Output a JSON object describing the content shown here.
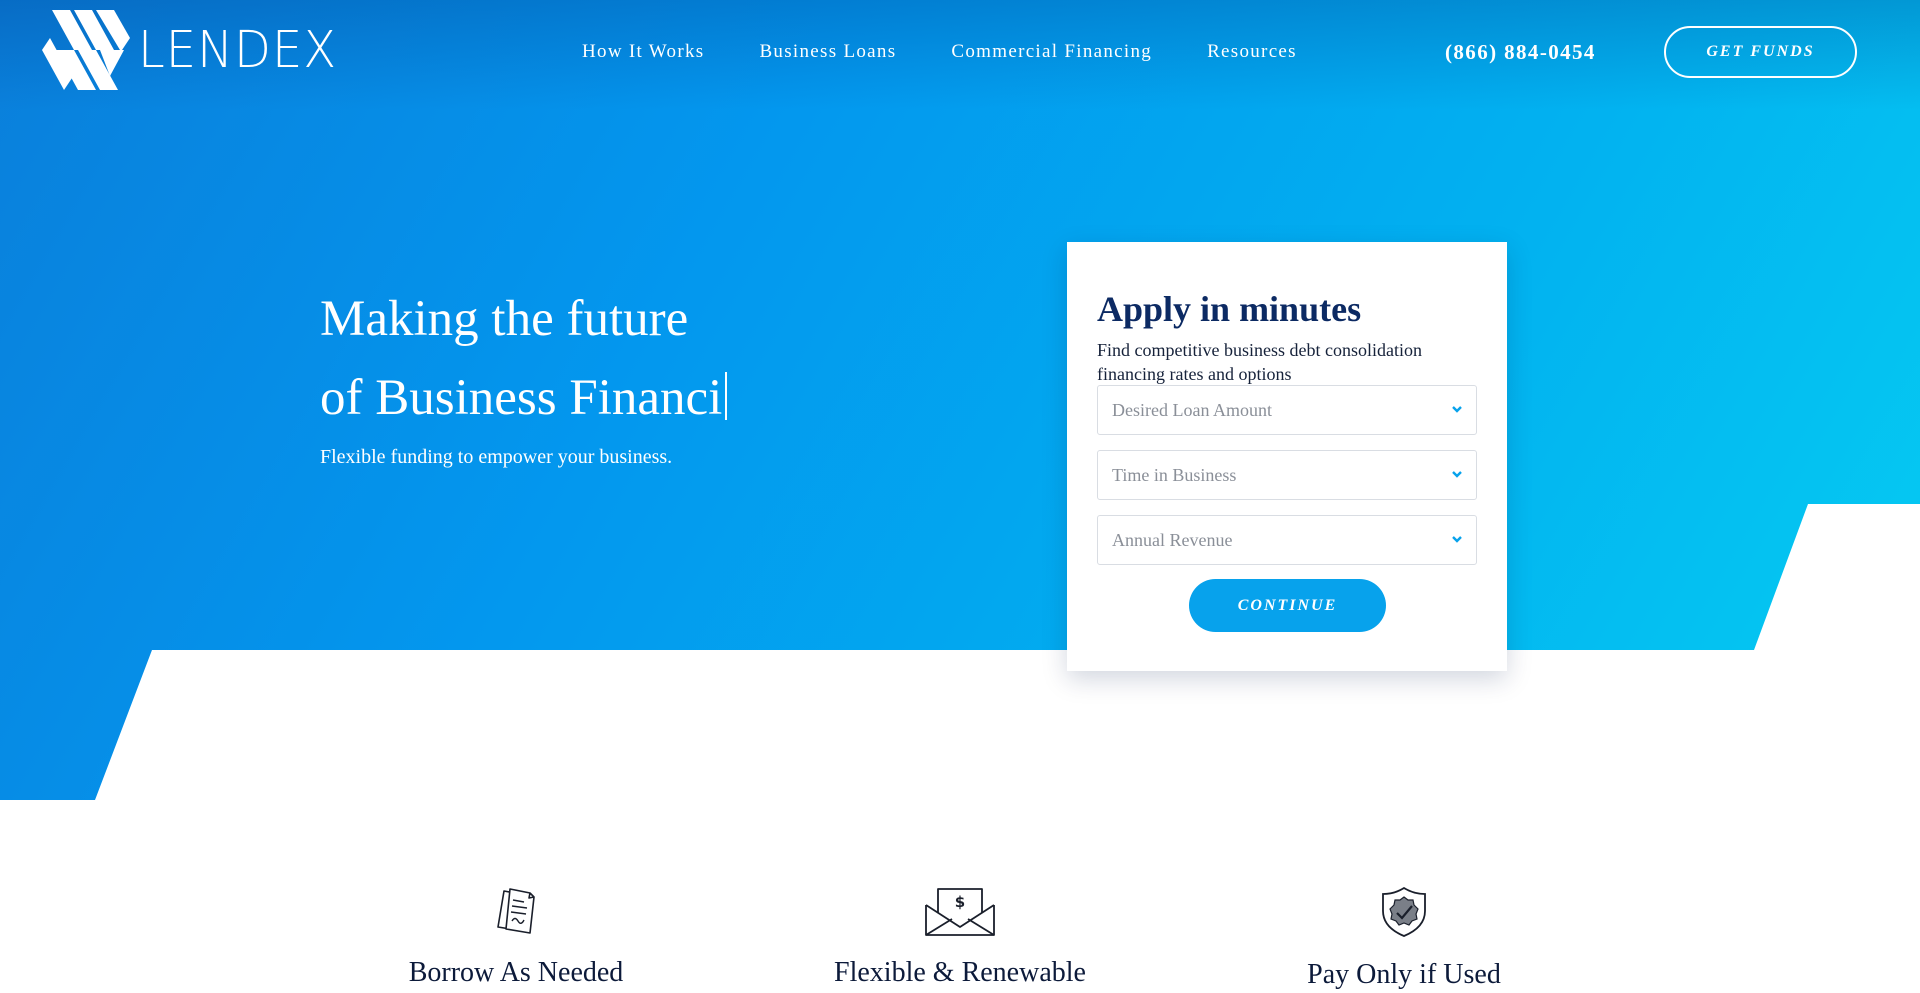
{
  "brand": {
    "name": "LENDEX"
  },
  "nav": {
    "items": [
      {
        "label": "How It Works"
      },
      {
        "label": "Business Loans"
      },
      {
        "label": "Commercial Financing"
      },
      {
        "label": "Resources"
      }
    ],
    "phone": "(866) 884-0454",
    "cta_label": "GET FUNDS"
  },
  "hero": {
    "headline_line1": "Making the future",
    "headline_line2": "of Business Financi",
    "subhead": "Flexible funding to empower your business."
  },
  "apply_form": {
    "title": "Apply in minutes",
    "description": "Find competitive business debt consolidation financing rates and options",
    "fields": [
      {
        "placeholder": "Desired Loan Amount"
      },
      {
        "placeholder": "Time in Business"
      },
      {
        "placeholder": "Annual Revenue"
      }
    ],
    "submit_label": "CONTINUE"
  },
  "features": [
    {
      "icon": "documents-icon",
      "label": "Borrow As Needed"
    },
    {
      "icon": "money-envelope-icon",
      "label": "Flexible & Renewable"
    },
    {
      "icon": "shield-check-icon",
      "label": "Pay Only if Used"
    }
  ],
  "colors": {
    "hero_gradient_start": "#0a7fdb",
    "hero_gradient_end": "#06cdf2",
    "accent": "#07a2ec",
    "heading_navy": "#0c2a63"
  }
}
